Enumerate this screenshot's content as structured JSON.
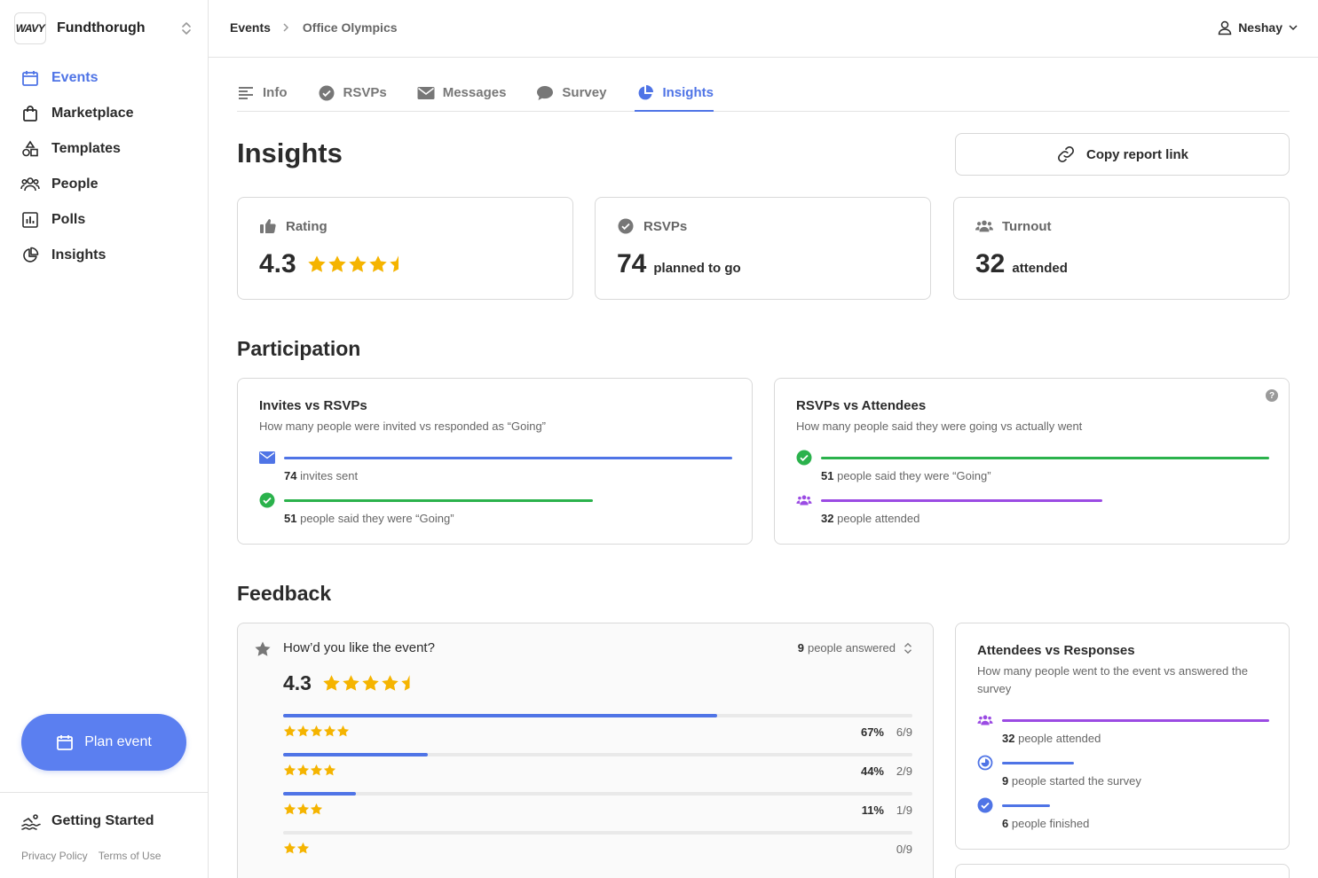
{
  "brand": {
    "logo_text": "WAVY",
    "name": "Fundthorugh"
  },
  "sidebar": {
    "items": [
      {
        "label": "Events",
        "icon": "calendar-icon",
        "active": true
      },
      {
        "label": "Marketplace",
        "icon": "shopping-bag-icon",
        "active": false
      },
      {
        "label": "Templates",
        "icon": "shapes-icon",
        "active": false
      },
      {
        "label": "People",
        "icon": "people-icon",
        "active": false
      },
      {
        "label": "Polls",
        "icon": "bar-chart-icon",
        "active": false
      },
      {
        "label": "Insights",
        "icon": "pie-chart-icon",
        "active": false
      }
    ],
    "plan_button": "Plan event",
    "getting_started": "Getting Started",
    "privacy": "Privacy Policy",
    "terms": "Terms of Use"
  },
  "header": {
    "breadcrumb_root": "Events",
    "breadcrumb_current": "Office Olympics",
    "user_name": "Neshay"
  },
  "tabs": [
    {
      "label": "Info",
      "icon": "lines-icon",
      "active": false
    },
    {
      "label": "RSVPs",
      "icon": "check-circle-icon",
      "active": false
    },
    {
      "label": "Messages",
      "icon": "envelope-icon",
      "active": false
    },
    {
      "label": "Survey",
      "icon": "chat-bubble-icon",
      "active": false
    },
    {
      "label": "Insights",
      "icon": "pie-chart-icon",
      "active": true
    }
  ],
  "page": {
    "title": "Insights",
    "copy_button": "Copy report link"
  },
  "stats": {
    "rating": {
      "label": "Rating",
      "value": "4.3"
    },
    "rsvps": {
      "label": "RSVPs",
      "value": "74",
      "suffix": "planned to go"
    },
    "turnout": {
      "label": "Turnout",
      "value": "32",
      "suffix": "attended"
    }
  },
  "participation": {
    "title": "Participation",
    "invites_card": {
      "title": "Invites vs RSVPs",
      "subtitle": "How many people were invited vs responded as “Going”",
      "rows": [
        {
          "count": "74",
          "text": "invites sent",
          "fraction": 1.0,
          "color": "#4f74e6",
          "icon": "envelope-icon"
        },
        {
          "count": "51",
          "text": "people said they were “Going”",
          "fraction": 0.689,
          "color": "#2bb24c",
          "icon": "check-circle-icon"
        }
      ]
    },
    "attendees_card": {
      "title": "RSVPs vs Attendees",
      "subtitle": "How many people said they were going vs actually went",
      "help": "?",
      "rows": [
        {
          "count": "51",
          "text": "people said they were “Going”",
          "fraction": 1.0,
          "color": "#2bb24c",
          "icon": "check-circle-icon"
        },
        {
          "count": "32",
          "text": "people attended",
          "fraction": 0.627,
          "color": "#9b4be3",
          "icon": "people-icon"
        }
      ]
    }
  },
  "feedback": {
    "title": "Feedback",
    "question": "How’d you like the event?",
    "answered_count": "9",
    "answered_text": "people answered",
    "rating": "4.3",
    "distribution": [
      {
        "stars": 5,
        "pct": "67%",
        "frac": "6/9",
        "fill": 0.69
      },
      {
        "stars": 4,
        "pct": "44%",
        "frac": "2/9",
        "fill": 0.23
      },
      {
        "stars": 3,
        "pct": "11%",
        "frac": "1/9",
        "fill": 0.115
      },
      {
        "stars": 2,
        "pct": "",
        "frac": "0/9",
        "fill": 0
      }
    ],
    "attendees_card": {
      "title": "Attendees vs Responses",
      "subtitle": "How many people went to the event vs answered the survey",
      "rows": [
        {
          "count": "32",
          "text": "people attended",
          "fraction": 1.0,
          "color": "#9b4be3",
          "icon": "people-icon"
        },
        {
          "count": "9",
          "text": "people started the survey",
          "fraction": 0.27,
          "color": "#4f74e6",
          "icon": "progress-circle-icon"
        },
        {
          "count": "6",
          "text": "people finished",
          "fraction": 0.18,
          "color": "#4f74e6",
          "icon": "check-circle-icon"
        }
      ]
    }
  },
  "colors": {
    "accent": "#4f74e6",
    "green": "#2bb24c",
    "purple": "#9b4be3",
    "star": "#f5b400"
  }
}
